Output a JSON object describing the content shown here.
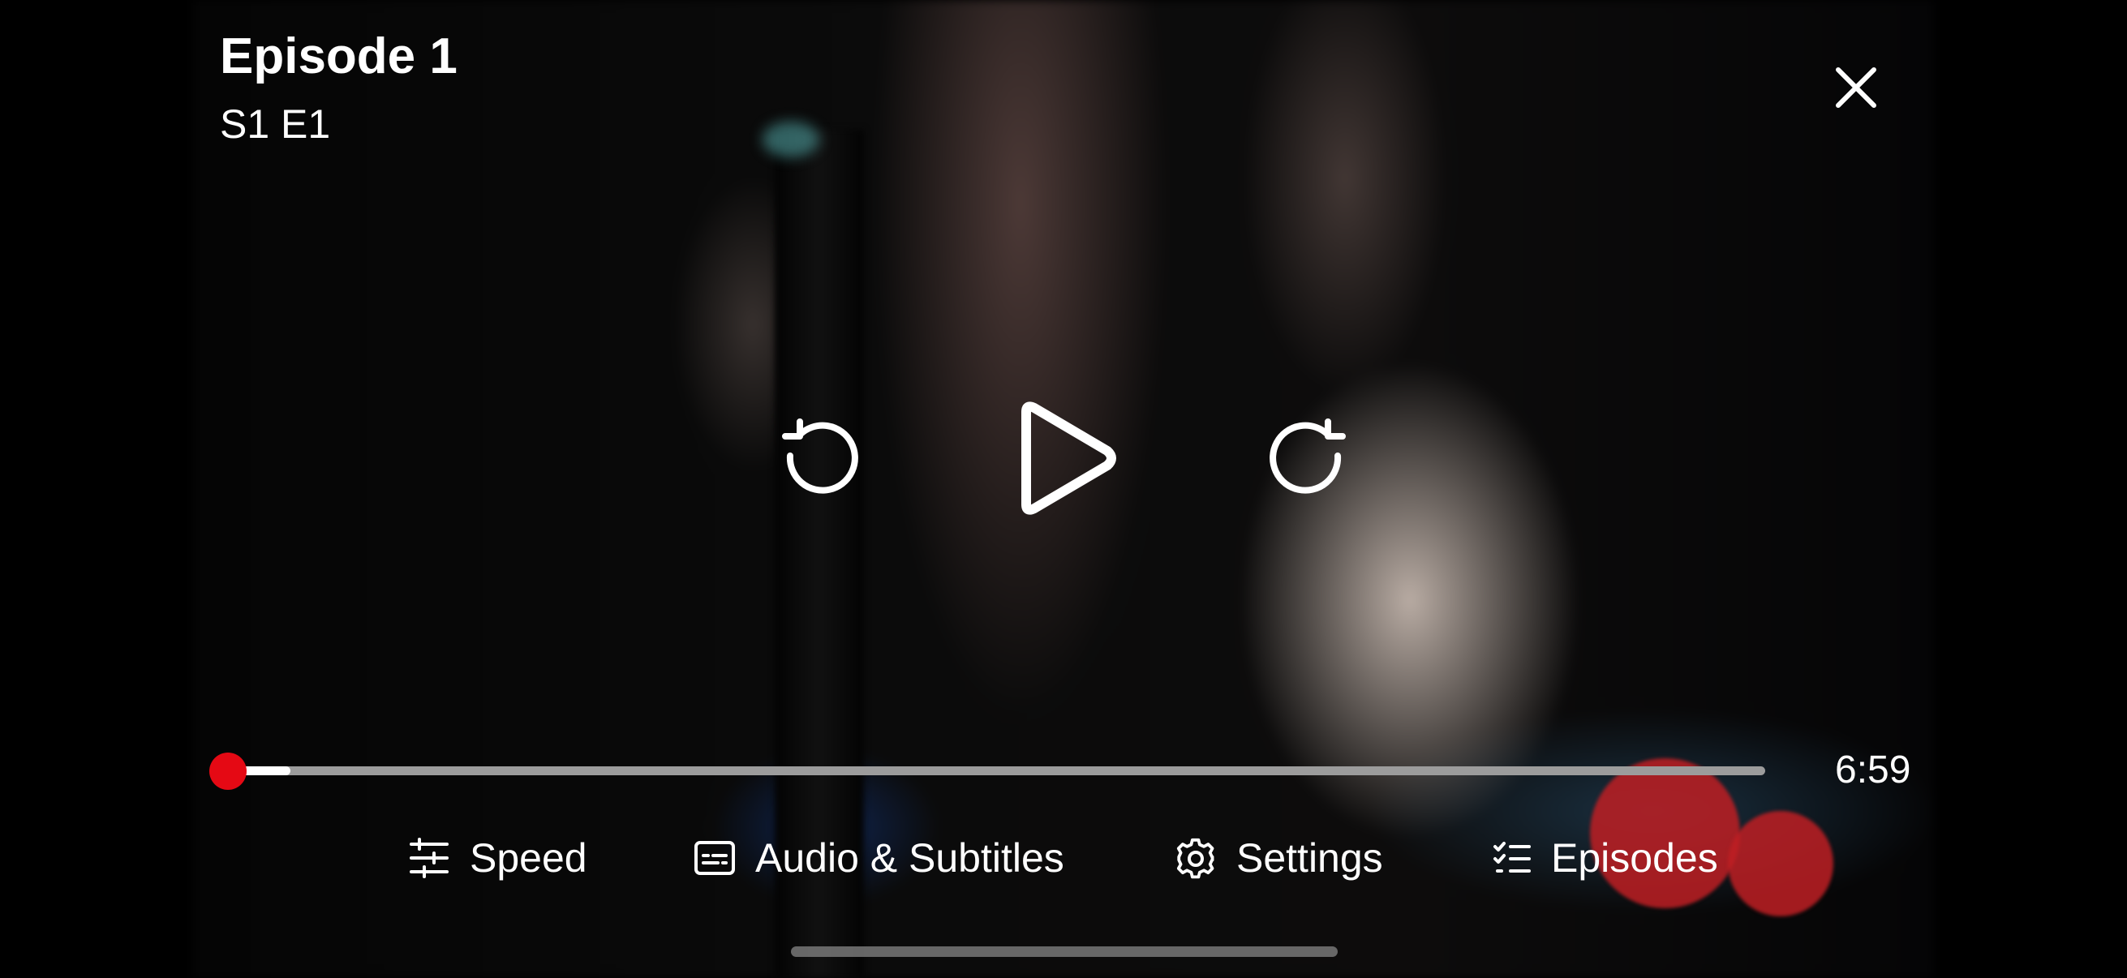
{
  "header": {
    "title": "Episode 1",
    "subtitle": "S1 E1"
  },
  "controls": {
    "rewind_icon": "rewind-icon",
    "play_icon": "play-icon",
    "forward_icon": "forward-icon",
    "close_icon": "close-icon"
  },
  "progress": {
    "played_fraction": 0.01,
    "buffered_fraction": 0.05,
    "remaining_time": "6:59"
  },
  "menu": {
    "speed_label": "Speed",
    "audio_label": "Audio & Subtitles",
    "settings_label": "Settings",
    "episodes_label": "Episodes"
  },
  "colors": {
    "accent": "#e50914",
    "track": "#9c9c9c",
    "buffer": "#ffffff",
    "text": "#ffffff"
  }
}
